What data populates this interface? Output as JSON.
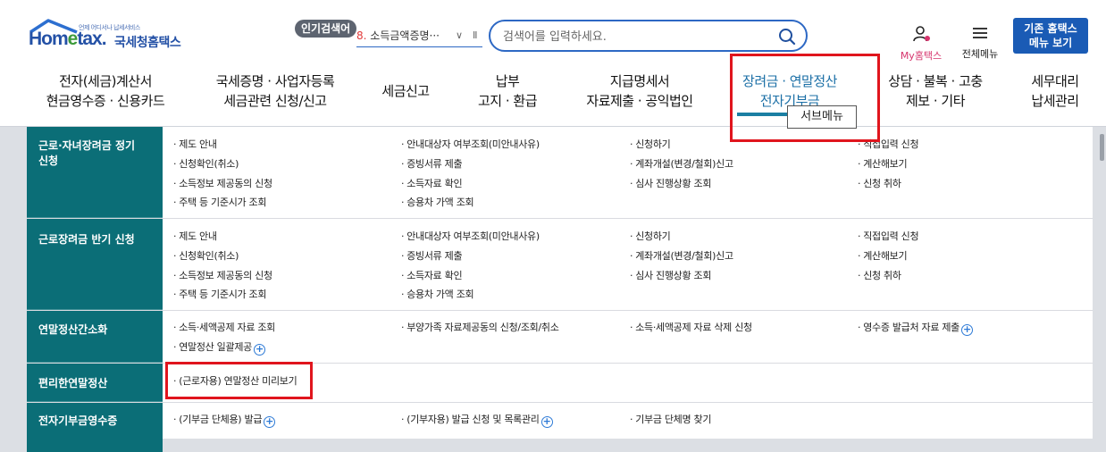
{
  "logo": {
    "sub": "언제 어디서나 납세서비스",
    "main_pre": "Hom",
    "main_e": "e",
    "main_post": "tax.",
    "kor": "국세청홈택스"
  },
  "popular": {
    "badge": "인기검색어",
    "rank": "8.",
    "text": "소득금액증명···",
    "chevron": "∨",
    "pause": "II"
  },
  "search": {
    "placeholder": "검색어를 입력하세요."
  },
  "utility": {
    "myhome": "My홈택스",
    "allmenu": "전체메뉴",
    "classic_line1": "기존 홈택스",
    "classic_line2": "메뉴 보기"
  },
  "gnb": [
    {
      "line1": "전자(세금)계산서",
      "line2": "현금영수증 · 신용카드"
    },
    {
      "line1": "국세증명 · 사업자등록",
      "line2": "세금관련 신청/신고"
    },
    {
      "line1": "세금신고",
      "line2": ""
    },
    {
      "line1": "납부",
      "line2": "고지 · 환급"
    },
    {
      "line1": "지급명세서",
      "line2": "자료제출 · 공익법인"
    },
    {
      "line1": "장려금 · 연말정산",
      "line2": "전자기부금"
    },
    {
      "line1": "상담 · 불복 · 고충",
      "line2": "제보 · 기타"
    },
    {
      "line1": "세무대리",
      "line2": "납세관리"
    }
  ],
  "tooltip": "서브메뉴",
  "rows": [
    {
      "label1": "근로·자녀장려금 정기",
      "label2": "신청",
      "links": [
        [
          "제도 안내",
          "신청확인(취소)",
          "소득정보 제공동의 신청",
          "주택 등 기준시가 조회"
        ],
        [
          "안내대상자 여부조회(미안내사유)",
          "증빙서류 제출",
          "소득자료 확인",
          "승용차 가액 조회"
        ],
        [
          "신청하기",
          "계좌개설(변경/철회)신고",
          "심사 진행상황 조회"
        ],
        [
          "직접입력 신청",
          "계산해보기",
          "신청 취하"
        ]
      ]
    },
    {
      "label1": "근로장려금 반기 신청",
      "label2": "",
      "links": [
        [
          "제도 안내",
          "신청확인(취소)",
          "소득정보 제공동의 신청",
          "주택 등 기준시가 조회"
        ],
        [
          "안내대상자 여부조회(미안내사유)",
          "증빙서류 제출",
          "소득자료 확인",
          "승용차 가액 조회"
        ],
        [
          "신청하기",
          "계좌개설(변경/철회)신고",
          "심사 진행상황 조회"
        ],
        [
          "직접입력 신청",
          "계산해보기",
          "신청 취하"
        ]
      ]
    },
    {
      "label1": "연말정산간소화",
      "label2": "",
      "links": [
        [
          "소득·세액공제 자료 조회",
          "연말정산 일괄제공"
        ],
        [
          "부양가족 자료제공동의 신청/조회/취소"
        ],
        [
          "소득·세액공제 자료 삭제 신청"
        ],
        [
          "영수증 발급처 자료 제출"
        ]
      ]
    },
    {
      "label1": "편리한연말정산",
      "label2": "",
      "links": [
        [
          "(근로자용) 연말정산 미리보기"
        ]
      ]
    },
    {
      "label1": "전자기부금영수증",
      "label2": "",
      "links": [
        [
          "(기부금 단체용) 발급"
        ],
        [
          "(기부자용) 발급 신청 및 목록관리"
        ],
        [
          "기부금 단체명 찾기"
        ]
      ]
    }
  ]
}
